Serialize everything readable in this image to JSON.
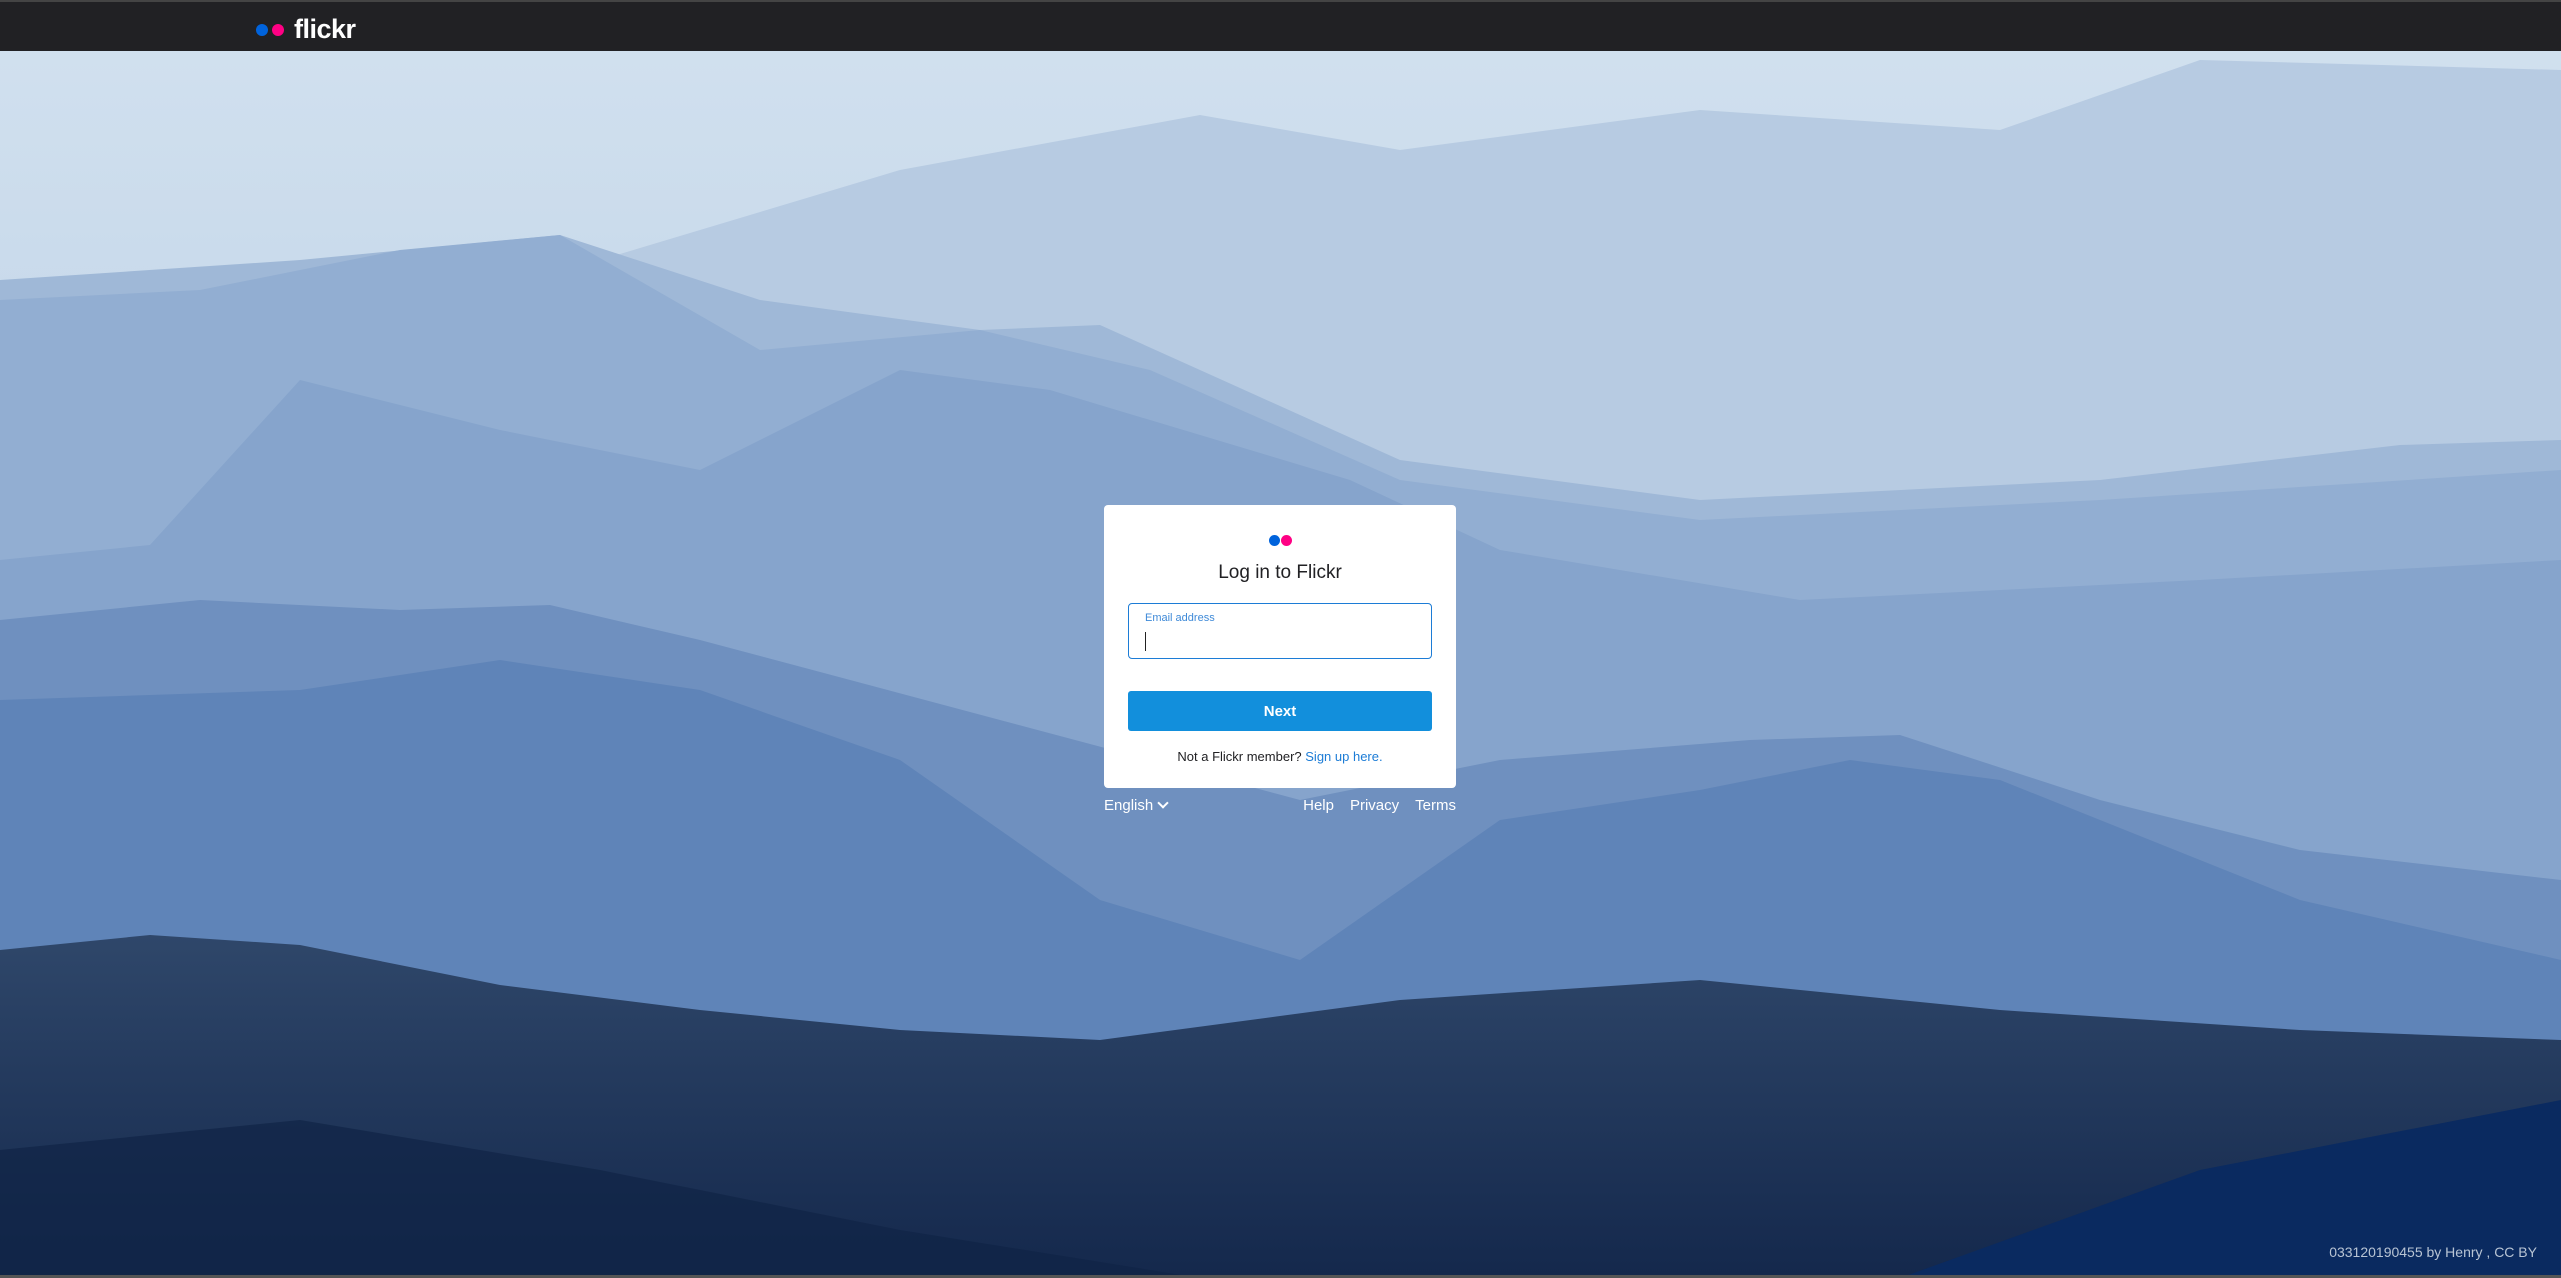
{
  "header": {
    "logo_text": "flickr",
    "colors": {
      "blue": "#0063dc",
      "pink": "#ff0084"
    }
  },
  "login": {
    "title": "Log in to Flickr",
    "email_label": "Email address",
    "email_value": "",
    "next_label": "Next",
    "signup_prompt": "Not a Flickr member?",
    "signup_link": "Sign up here."
  },
  "footer": {
    "language": "English",
    "links": [
      "Help",
      "Privacy",
      "Terms"
    ]
  },
  "photo_credit": "033120190455 by Henry , CC BY"
}
